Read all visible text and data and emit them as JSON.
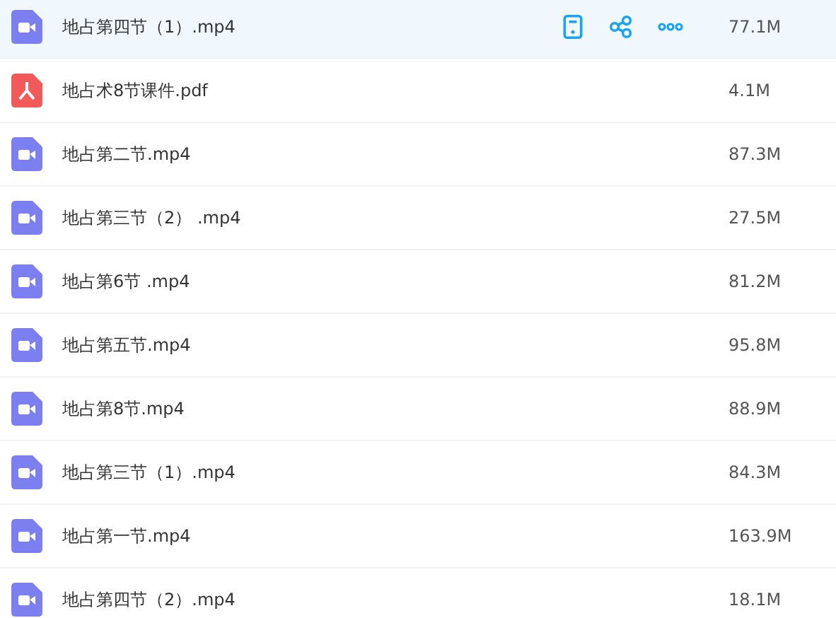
{
  "files": [
    {
      "kind": "video",
      "name": "地占第四节（1）.mp4",
      "size": "77.1M",
      "hovered": true
    },
    {
      "kind": "pdf",
      "name": "地占术8节课件.pdf",
      "size": "4.1M",
      "hovered": false
    },
    {
      "kind": "video",
      "name": "地占第二节.mp4",
      "size": "87.3M",
      "hovered": false
    },
    {
      "kind": "video",
      "name": "地占第三节（2） .mp4",
      "size": "27.5M",
      "hovered": false
    },
    {
      "kind": "video",
      "name": "地占第6节 .mp4",
      "size": "81.2M",
      "hovered": false
    },
    {
      "kind": "video",
      "name": "地占第五节.mp4",
      "size": "95.8M",
      "hovered": false
    },
    {
      "kind": "video",
      "name": "地占第8节.mp4",
      "size": "88.9M",
      "hovered": false
    },
    {
      "kind": "video",
      "name": "地占第三节（1）.mp4",
      "size": "84.3M",
      "hovered": false
    },
    {
      "kind": "video",
      "name": "地占第一节.mp4",
      "size": "163.9M",
      "hovered": false
    },
    {
      "kind": "video",
      "name": "地占第四节（2）.mp4",
      "size": "18.1M",
      "hovered": false
    }
  ]
}
